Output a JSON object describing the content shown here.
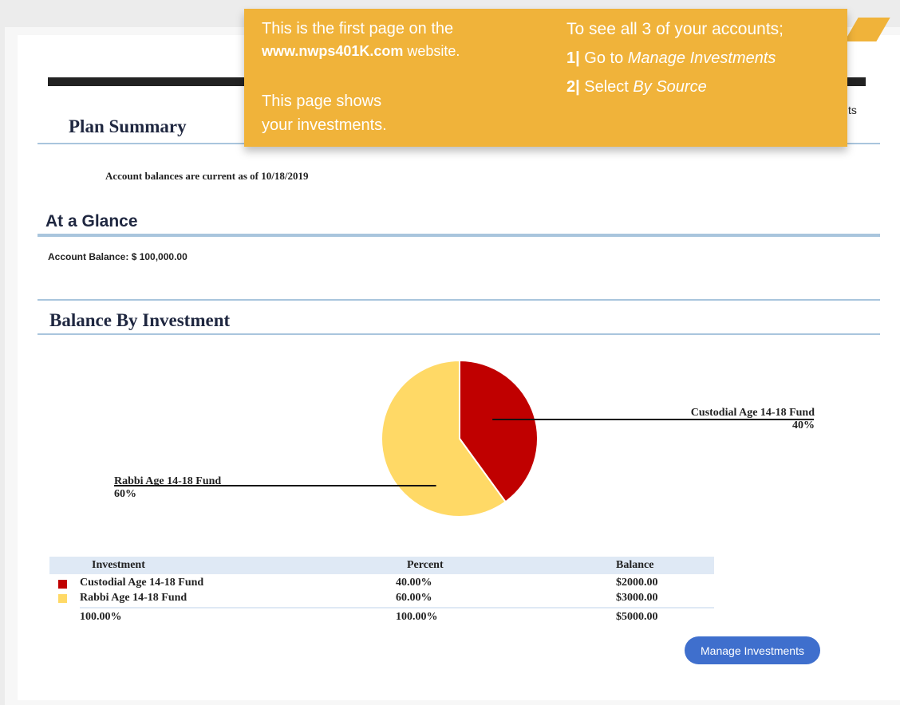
{
  "header": {
    "partial_text": "ts"
  },
  "callout": {
    "left_line1": "This is the first page on the",
    "left_line2_url": "www.nwps401K.com",
    "left_line2_rest": " website.",
    "left_line3": "This page shows",
    "left_line4": "your investments.",
    "right_line1": "To see all 3 of your accounts;",
    "right_step1_num": "1|",
    "right_step1_text": " Go to ",
    "right_step1_em": "Manage Investments",
    "right_step2_num": "2|",
    "right_step2_text": " Select ",
    "right_step2_em": "By Source"
  },
  "summary": {
    "title": "Plan Summary",
    "as_of": "Account balances are current as of 10/18/2019"
  },
  "glance": {
    "title": "At a Glance",
    "balance": "Account Balance: $ 100,000.00"
  },
  "investment": {
    "title": "Balance By Investment"
  },
  "chart_data": {
    "type": "pie",
    "slices": [
      {
        "label": "Custodial Age 14-18 Fund",
        "value": 40,
        "percent_label": "40%",
        "color": "#c00000"
      },
      {
        "label": "Rabbi Age 14-18 Fund",
        "value": 60,
        "percent_label": "60%",
        "color": "#ffd966"
      }
    ]
  },
  "table": {
    "headers": [
      "Investment",
      "Percent",
      "Balance"
    ],
    "rows": [
      {
        "name": "Custodial Age 14-18 Fund",
        "percent": "40.00%",
        "balance": "$2000.00",
        "color": "#c00000"
      },
      {
        "name": "Rabbi Age 14-18 Fund",
        "percent": "60.00%",
        "balance": "$3000.00",
        "color": "#ffd966"
      }
    ],
    "total": {
      "name": "100.00%",
      "percent": "100.00%",
      "balance": "$5000.00"
    }
  },
  "actions": {
    "manage_label": "Manage Investments"
  }
}
